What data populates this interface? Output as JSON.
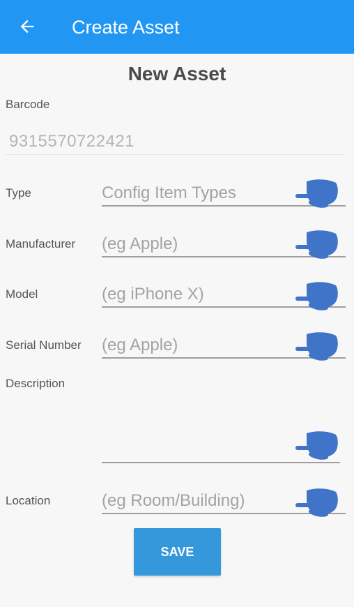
{
  "appbar": {
    "title": "Create Asset",
    "back_icon": "arrow-left-icon",
    "color": "#2196f3"
  },
  "form": {
    "heading": "New Asset",
    "barcode": {
      "label": "Barcode",
      "value": "9315570722421"
    },
    "type": {
      "label": "Type",
      "placeholder": "Config Item Types"
    },
    "manufacturer": {
      "label": "Manufacturer",
      "placeholder": "(eg Apple)"
    },
    "model": {
      "label": "Model",
      "placeholder": "(eg iPhone X)"
    },
    "serial_number": {
      "label": "Serial Number",
      "placeholder": "(eg Apple)"
    },
    "description": {
      "label": "Description",
      "placeholder": ""
    },
    "location": {
      "label": "Location",
      "placeholder": "(eg Room/Building)"
    },
    "save_label": "SAVE",
    "save_color": "#3498db"
  },
  "pointer_icon": "pointing-hand-icon",
  "pointer_color": "#3f74c8"
}
